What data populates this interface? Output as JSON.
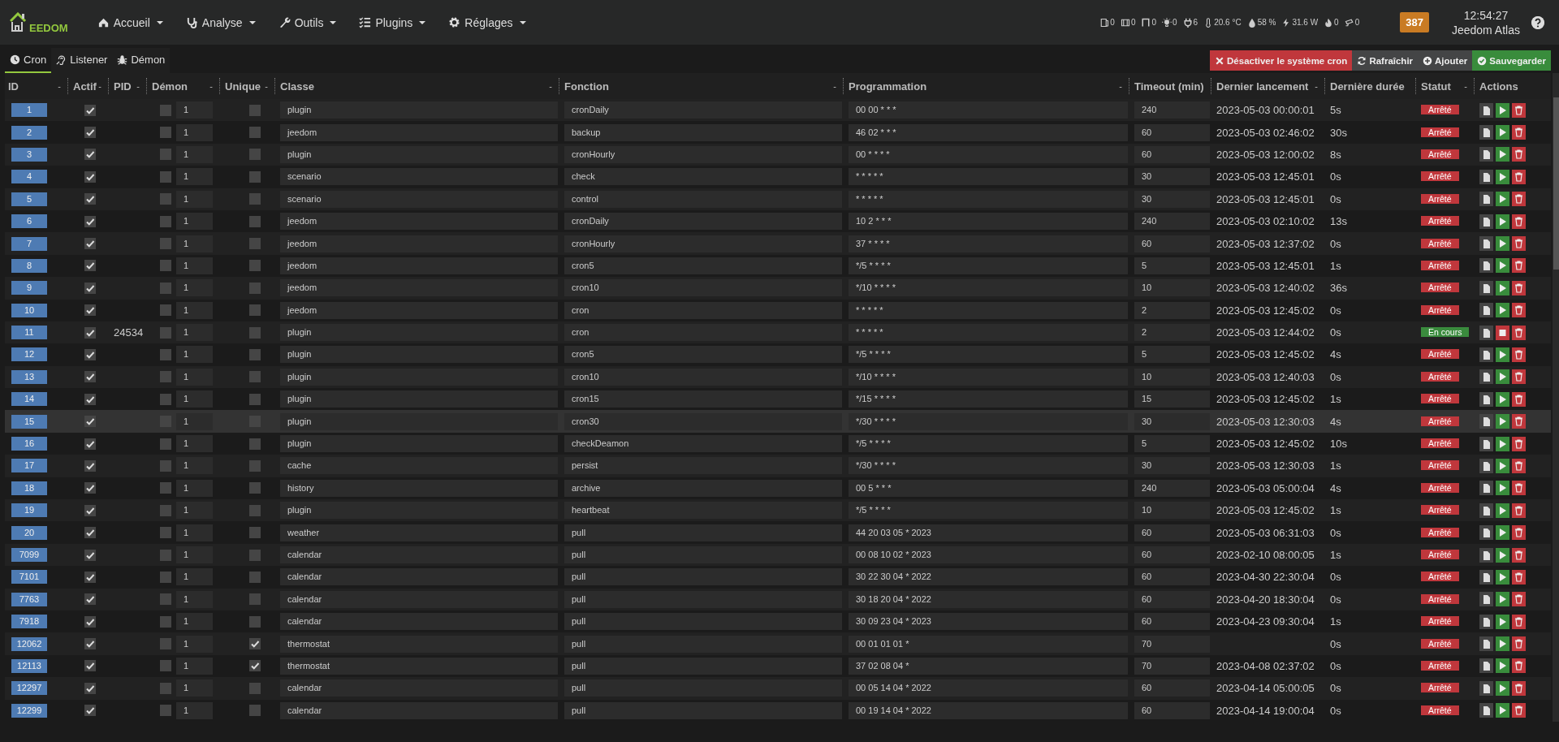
{
  "navbar": {
    "logo_text": "EEDOM",
    "menus": [
      {
        "label": "Accueil",
        "kind": "home"
      },
      {
        "label": "Analyse",
        "kind": "stethoscope"
      },
      {
        "label": "Outils",
        "kind": "wrench"
      },
      {
        "label": "Plugins",
        "kind": "list"
      },
      {
        "label": "Réglages",
        "kind": "gear"
      }
    ],
    "summary": [
      {
        "kind": "door",
        "value": "0"
      },
      {
        "kind": "window",
        "value": "0"
      },
      {
        "kind": "shutter",
        "value": "0"
      },
      {
        "kind": "light",
        "value": "0"
      },
      {
        "kind": "plug",
        "value": "6"
      },
      {
        "kind": "thermometer",
        "value": "20.6 °C"
      },
      {
        "kind": "drop",
        "value": "58 %"
      },
      {
        "kind": "bolt",
        "value": "31.6 W"
      },
      {
        "kind": "flame",
        "value": "0"
      },
      {
        "kind": "camera",
        "value": "0"
      }
    ],
    "message_count": "387",
    "time": "12:54:27",
    "user": "Jeedom Atlas"
  },
  "tabs": [
    {
      "label": "Cron",
      "kind": "clock",
      "selected": true
    },
    {
      "label": "Listener",
      "kind": "ear",
      "selected": false
    },
    {
      "label": "Démon",
      "kind": "bug",
      "selected": false
    }
  ],
  "toolbar": [
    {
      "label": "Désactiver le système cron",
      "kind": "disable"
    },
    {
      "label": "Rafraîchir",
      "kind": "refresh"
    },
    {
      "label": "Ajouter",
      "kind": "add"
    },
    {
      "label": "Sauvegarder",
      "kind": "save"
    }
  ],
  "table": {
    "columns": [
      {
        "label": "ID",
        "sort": "-"
      },
      {
        "label": "Actif",
        "sort": "-"
      },
      {
        "label": "PID",
        "sort": "-"
      },
      {
        "label": "Démon",
        "sort": "-"
      },
      {
        "label": "Unique",
        "sort": "-"
      },
      {
        "label": "Classe",
        "sort": "-"
      },
      {
        "label": "Fonction",
        "sort": "-"
      },
      {
        "label": "Programmation",
        "sort": "-"
      },
      {
        "label": "Timeout (min)"
      },
      {
        "label": "Dernier lancement",
        "sort": "-"
      },
      {
        "label": "Dernière durée"
      },
      {
        "label": "Statut",
        "sort": "-"
      },
      {
        "label": "Actions"
      }
    ],
    "rows": [
      {
        "id": "1",
        "active": true,
        "demon": false,
        "demon_value": "1",
        "unique": false,
        "class": "plugin",
        "function": "cronDaily",
        "schedule": "00 00 * * *",
        "timeout": "240",
        "last_run": "2023-05-03 00:00:01",
        "duration": "5s",
        "status": {
          "kind": "stopped",
          "label": "Arrêté"
        },
        "selected": false
      },
      {
        "id": "2",
        "active": true,
        "demon": false,
        "demon_value": "1",
        "unique": false,
        "class": "jeedom",
        "function": "backup",
        "schedule": "46 02 * * *",
        "timeout": "60",
        "last_run": "2023-05-03 02:46:02",
        "duration": "30s",
        "status": {
          "kind": "stopped",
          "label": "Arrêté"
        },
        "selected": false
      },
      {
        "id": "3",
        "active": true,
        "demon": false,
        "demon_value": "1",
        "unique": false,
        "class": "plugin",
        "function": "cronHourly",
        "schedule": "00 * * * *",
        "timeout": "60",
        "last_run": "2023-05-03 12:00:02",
        "duration": "8s",
        "status": {
          "kind": "stopped",
          "label": "Arrêté"
        },
        "selected": false
      },
      {
        "id": "4",
        "active": true,
        "demon": false,
        "demon_value": "1",
        "unique": false,
        "class": "scenario",
        "function": "check",
        "schedule": "* * * * *",
        "timeout": "30",
        "last_run": "2023-05-03 12:45:01",
        "duration": "0s",
        "status": {
          "kind": "stopped",
          "label": "Arrêté"
        },
        "selected": false
      },
      {
        "id": "5",
        "active": true,
        "demon": false,
        "demon_value": "1",
        "unique": false,
        "class": "scenario",
        "function": "control",
        "schedule": "* * * * *",
        "timeout": "30",
        "last_run": "2023-05-03 12:45:01",
        "duration": "0s",
        "status": {
          "kind": "stopped",
          "label": "Arrêté"
        },
        "selected": false
      },
      {
        "id": "6",
        "active": true,
        "demon": false,
        "demon_value": "1",
        "unique": false,
        "class": "jeedom",
        "function": "cronDaily",
        "schedule": "10 2 * * *",
        "timeout": "240",
        "last_run": "2023-05-03 02:10:02",
        "duration": "13s",
        "status": {
          "kind": "stopped",
          "label": "Arrêté"
        },
        "selected": false
      },
      {
        "id": "7",
        "active": true,
        "demon": false,
        "demon_value": "1",
        "unique": false,
        "class": "jeedom",
        "function": "cronHourly",
        "schedule": "37 * * * *",
        "timeout": "60",
        "last_run": "2023-05-03 12:37:02",
        "duration": "0s",
        "status": {
          "kind": "stopped",
          "label": "Arrêté"
        },
        "selected": false
      },
      {
        "id": "8",
        "active": true,
        "demon": false,
        "demon_value": "1",
        "unique": false,
        "class": "jeedom",
        "function": "cron5",
        "schedule": "*/5 * * * *",
        "timeout": "5",
        "last_run": "2023-05-03 12:45:01",
        "duration": "1s",
        "status": {
          "kind": "stopped",
          "label": "Arrêté"
        },
        "selected": false
      },
      {
        "id": "9",
        "active": true,
        "demon": false,
        "demon_value": "1",
        "unique": false,
        "class": "jeedom",
        "function": "cron10",
        "schedule": "*/10 * * * *",
        "timeout": "10",
        "last_run": "2023-05-03 12:40:02",
        "duration": "36s",
        "status": {
          "kind": "stopped",
          "label": "Arrêté"
        },
        "selected": false
      },
      {
        "id": "10",
        "active": true,
        "demon": false,
        "demon_value": "1",
        "unique": false,
        "class": "jeedom",
        "function": "cron",
        "schedule": "* * * * *",
        "timeout": "2",
        "last_run": "2023-05-03 12:45:02",
        "duration": "0s",
        "status": {
          "kind": "stopped",
          "label": "Arrêté"
        },
        "selected": false
      },
      {
        "id": "11",
        "active": true,
        "pid": "24534",
        "demon": false,
        "demon_value": "1",
        "unique": false,
        "class": "plugin",
        "function": "cron",
        "schedule": "* * * * *",
        "timeout": "2",
        "last_run": "2023-05-03 12:44:02",
        "duration": "0s",
        "status": {
          "kind": "running",
          "label": "En cours"
        },
        "selected": false
      },
      {
        "id": "12",
        "active": true,
        "demon": false,
        "demon_value": "1",
        "unique": false,
        "class": "plugin",
        "function": "cron5",
        "schedule": "*/5 * * * *",
        "timeout": "5",
        "last_run": "2023-05-03 12:45:02",
        "duration": "4s",
        "status": {
          "kind": "stopped",
          "label": "Arrêté"
        },
        "selected": false
      },
      {
        "id": "13",
        "active": true,
        "demon": false,
        "demon_value": "1",
        "unique": false,
        "class": "plugin",
        "function": "cron10",
        "schedule": "*/10 * * * *",
        "timeout": "10",
        "last_run": "2023-05-03 12:40:03",
        "duration": "0s",
        "status": {
          "kind": "stopped",
          "label": "Arrêté"
        },
        "selected": false
      },
      {
        "id": "14",
        "active": true,
        "demon": false,
        "demon_value": "1",
        "unique": false,
        "class": "plugin",
        "function": "cron15",
        "schedule": "*/15 * * * *",
        "timeout": "15",
        "last_run": "2023-05-03 12:45:02",
        "duration": "1s",
        "status": {
          "kind": "stopped",
          "label": "Arrêté"
        },
        "selected": false
      },
      {
        "id": "15",
        "active": true,
        "demon": false,
        "demon_value": "1",
        "unique": false,
        "class": "plugin",
        "function": "cron30",
        "schedule": "*/30 * * * *",
        "timeout": "30",
        "last_run": "2023-05-03 12:30:03",
        "duration": "4s",
        "status": {
          "kind": "stopped",
          "label": "Arrêté"
        },
        "selected": true
      },
      {
        "id": "16",
        "active": true,
        "demon": false,
        "demon_value": "1",
        "unique": false,
        "class": "plugin",
        "function": "checkDeamon",
        "schedule": "*/5 * * * *",
        "timeout": "5",
        "last_run": "2023-05-03 12:45:02",
        "duration": "10s",
        "status": {
          "kind": "stopped",
          "label": "Arrêté"
        },
        "selected": false
      },
      {
        "id": "17",
        "active": true,
        "demon": false,
        "demon_value": "1",
        "unique": false,
        "class": "cache",
        "function": "persist",
        "schedule": "*/30 * * * *",
        "timeout": "30",
        "last_run": "2023-05-03 12:30:03",
        "duration": "1s",
        "status": {
          "kind": "stopped",
          "label": "Arrêté"
        },
        "selected": false
      },
      {
        "id": "18",
        "active": true,
        "demon": false,
        "demon_value": "1",
        "unique": false,
        "class": "history",
        "function": "archive",
        "schedule": "00 5 * * *",
        "timeout": "240",
        "last_run": "2023-05-03 05:00:04",
        "duration": "4s",
        "status": {
          "kind": "stopped",
          "label": "Arrêté"
        },
        "selected": false
      },
      {
        "id": "19",
        "active": true,
        "demon": false,
        "demon_value": "1",
        "unique": false,
        "class": "plugin",
        "function": "heartbeat",
        "schedule": "*/5 * * * *",
        "timeout": "10",
        "last_run": "2023-05-03 12:45:02",
        "duration": "1s",
        "status": {
          "kind": "stopped",
          "label": "Arrêté"
        },
        "selected": false
      },
      {
        "id": "20",
        "active": true,
        "demon": false,
        "demon_value": "1",
        "unique": false,
        "class": "weather",
        "function": "pull",
        "schedule": "44 20 03 05 * 2023",
        "timeout": "60",
        "last_run": "2023-05-03 06:31:03",
        "duration": "0s",
        "status": {
          "kind": "stopped",
          "label": "Arrêté"
        },
        "selected": false
      },
      {
        "id": "7099",
        "active": true,
        "demon": false,
        "demon_value": "1",
        "unique": false,
        "class": "calendar",
        "function": "pull",
        "schedule": "00 08 10 02 * 2023",
        "timeout": "60",
        "last_run": "2023-02-10 08:00:05",
        "duration": "1s",
        "status": {
          "kind": "stopped",
          "label": "Arrêté"
        },
        "selected": false
      },
      {
        "id": "7101",
        "active": true,
        "demon": false,
        "demon_value": "1",
        "unique": false,
        "class": "calendar",
        "function": "pull",
        "schedule": "30 22 30 04 * 2022",
        "timeout": "60",
        "last_run": "2023-04-30 22:30:04",
        "duration": "0s",
        "status": {
          "kind": "stopped",
          "label": "Arrêté"
        },
        "selected": false
      },
      {
        "id": "7763",
        "active": true,
        "demon": false,
        "demon_value": "1",
        "unique": false,
        "class": "calendar",
        "function": "pull",
        "schedule": "30 18 20 04 * 2022",
        "timeout": "60",
        "last_run": "2023-04-20 18:30:04",
        "duration": "0s",
        "status": {
          "kind": "stopped",
          "label": "Arrêté"
        },
        "selected": false
      },
      {
        "id": "7918",
        "active": true,
        "demon": false,
        "demon_value": "1",
        "unique": false,
        "class": "calendar",
        "function": "pull",
        "schedule": "30 09 23 04 * 2023",
        "timeout": "60",
        "last_run": "2023-04-23 09:30:04",
        "duration": "1s",
        "status": {
          "kind": "stopped",
          "label": "Arrêté"
        },
        "selected": false
      },
      {
        "id": "12062",
        "active": true,
        "demon": false,
        "demon_value": "1",
        "unique": true,
        "class": "thermostat",
        "function": "pull",
        "schedule": "00 01 01 01 *",
        "timeout": "70",
        "duration": "0s",
        "status": {
          "kind": "stopped",
          "label": "Arrêté"
        },
        "selected": false
      },
      {
        "id": "12113",
        "active": true,
        "demon": false,
        "demon_value": "1",
        "unique": true,
        "class": "thermostat",
        "function": "pull",
        "schedule": "37 02 08 04 *",
        "timeout": "70",
        "last_run": "2023-04-08 02:37:02",
        "duration": "0s",
        "status": {
          "kind": "stopped",
          "label": "Arrêté"
        },
        "selected": false
      },
      {
        "id": "12297",
        "active": true,
        "demon": false,
        "demon_value": "1",
        "unique": false,
        "class": "calendar",
        "function": "pull",
        "schedule": "00 05 14 04 * 2022",
        "timeout": "60",
        "last_run": "2023-04-14 05:00:05",
        "duration": "0s",
        "status": {
          "kind": "stopped",
          "label": "Arrêté"
        },
        "selected": false
      },
      {
        "id": "12299",
        "active": true,
        "demon": false,
        "demon_value": "1",
        "unique": false,
        "class": "calendar",
        "function": "pull",
        "schedule": "00 19 14 04 * 2022",
        "timeout": "60",
        "last_run": "2023-04-14 19:00:04",
        "duration": "0s",
        "status": {
          "kind": "stopped",
          "label": "Arrêté"
        },
        "selected": false
      }
    ]
  }
}
